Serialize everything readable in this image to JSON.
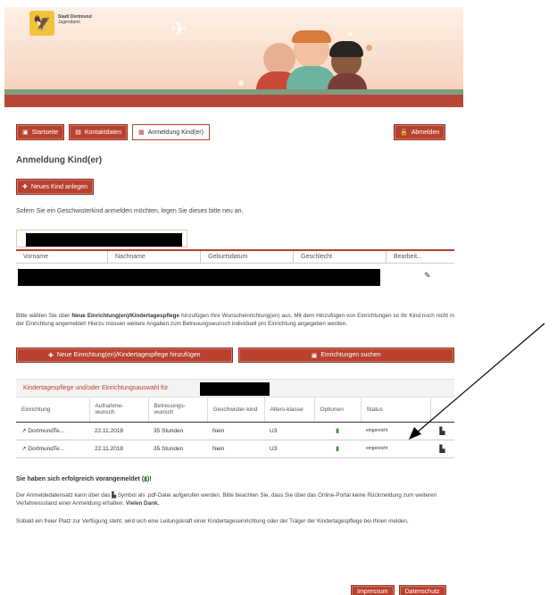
{
  "header": {
    "logo_line1": "Stadt Dortmund",
    "logo_line2": "Jugendamt",
    "crest_icon": "eagle-crest-icon"
  },
  "nav": {
    "items": [
      {
        "label": "Startseite",
        "icon": "home-icon",
        "style": "red"
      },
      {
        "label": "Kontaktdaten",
        "icon": "briefcase-icon",
        "style": "red"
      },
      {
        "label": "Anmeldung Kind(er)",
        "icon": "document-icon",
        "style": "white"
      }
    ],
    "logout_label": "Abmelden"
  },
  "page": {
    "title": "Anmeldung Kind(er)",
    "new_child_label": "Neues Kind anlegen",
    "sibling_info": "Sofern Sie ein Geschwisterkind anmelden möchten, legen Sie dieses bitte neu an."
  },
  "child_table": {
    "columns": [
      "Vorname",
      "Nachname",
      "Geburtsdatum",
      "Geschlecht",
      "Bearbeit..."
    ]
  },
  "instructions": {
    "part1": "Bitte wählen Sie über ",
    "bold1": "Neue Einrichtung(en)/Kindertagespflege",
    "part2": " hinzufügen Ihre Wunscheinrichtung(en) aus. Mit dem Hinzufügen von Einrichtungen ist Ihr Kind noch nicht in der Einrichtung angemeldet! Hierzu müssen weitere Angaben zum Betreuungswunsch individuell pro Einrichtung angegeben werden."
  },
  "actions": {
    "add_facility_label": "Neue Einrichtung(en)/Kindertagespflege hinzufügen",
    "search_facility_label": "Einrichtungen suchen"
  },
  "facility_section": {
    "title": "Kindertagespflege und/oder Einrichtungsauswahl für",
    "columns": [
      "Einrichtung",
      "Aufnahme-wunsch",
      "Betreuungs-wunsch",
      "Geschwister-kind",
      "Alters-klasse",
      "Optionen",
      "Status",
      ""
    ],
    "rows": [
      {
        "name": "DortmundTe...",
        "date": "22.11.2018",
        "hours": "35 Stunden",
        "sibling": "Nein",
        "age": "U3",
        "status": "eingereicht"
      },
      {
        "name": "DortmundTe...",
        "date": "22.11.2018",
        "hours": "35 Stunden",
        "sibling": "Nein",
        "age": "U3",
        "status": "eingereicht"
      }
    ]
  },
  "confirmation": {
    "success_prefix": "Sie haben sich erfolgreich vorangemeldet (",
    "success_suffix": ")!",
    "pdf_info_part1": "Der Anmeldedatensatz kann über das ",
    "pdf_info_part2": " Symbol als .pdf-Datei aufgerufen werden. Bitte beachten Sie, dass Sie über das Online-Portal keine Rückmeldung zum weiteren Verfahrensstand einer Anmeldung erhalten. ",
    "pdf_info_bold": "Vielen Dank.",
    "contact_info": "Sobald ein freier Platz zur Verfügung steht, wird sich eine Leitungskraft einer Kindertageseinrichtung oder der Träger der Kindertagespflege bei Ihnen melden."
  },
  "footer": {
    "impressum": "Impressum",
    "datenschutz": "Datenschutz"
  },
  "colors": {
    "accent": "#b9412f",
    "option_green": "#3a8a3a"
  }
}
